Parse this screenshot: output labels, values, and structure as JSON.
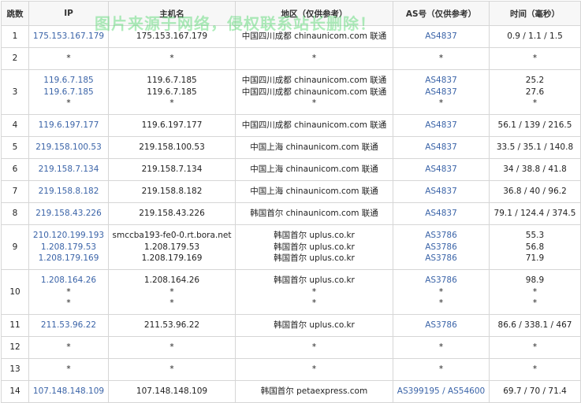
{
  "headers": {
    "hop": "跳数",
    "ip": "IP",
    "host": "主机名",
    "region": "地区（仅供参考）",
    "asn": "AS号（仅供参考）",
    "time": "时间（毫秒）"
  },
  "watermark": "图片来源于网络，侵权联系站长删除！",
  "rows": [
    {
      "hop": "1",
      "ip": [
        "175.153.167.179"
      ],
      "host": [
        "175.153.167.179"
      ],
      "region": [
        "中国四川成都 chinaunicom.com 联通"
      ],
      "asn": [
        "AS4837"
      ],
      "time": [
        "0.9 / 1.1 / 1.5"
      ]
    },
    {
      "hop": "2",
      "ip": [
        "*"
      ],
      "host": [
        "*"
      ],
      "region": [
        "*"
      ],
      "asn": [
        "*"
      ],
      "time": [
        "*"
      ]
    },
    {
      "hop": "3",
      "ip": [
        "119.6.7.185",
        "119.6.7.185",
        "*"
      ],
      "host": [
        "119.6.7.185",
        "119.6.7.185",
        "*"
      ],
      "region": [
        "中国四川成都 chinaunicom.com 联通",
        "中国四川成都 chinaunicom.com 联通",
        "*"
      ],
      "asn": [
        "AS4837",
        "AS4837",
        "*"
      ],
      "time": [
        "25.2",
        "27.6",
        "*"
      ]
    },
    {
      "hop": "4",
      "ip": [
        "119.6.197.177"
      ],
      "host": [
        "119.6.197.177"
      ],
      "region": [
        "中国四川成都 chinaunicom.com 联通"
      ],
      "asn": [
        "AS4837"
      ],
      "time": [
        "56.1 / 139 / 216.5"
      ]
    },
    {
      "hop": "5",
      "ip": [
        "219.158.100.53"
      ],
      "host": [
        "219.158.100.53"
      ],
      "region": [
        "中国上海 chinaunicom.com 联通"
      ],
      "asn": [
        "AS4837"
      ],
      "time": [
        "33.5 / 35.1 / 140.8"
      ]
    },
    {
      "hop": "6",
      "ip": [
        "219.158.7.134"
      ],
      "host": [
        "219.158.7.134"
      ],
      "region": [
        "中国上海 chinaunicom.com 联通"
      ],
      "asn": [
        "AS4837"
      ],
      "time": [
        "34 / 38.8 / 41.8"
      ]
    },
    {
      "hop": "7",
      "ip": [
        "219.158.8.182"
      ],
      "host": [
        "219.158.8.182"
      ],
      "region": [
        "中国上海 chinaunicom.com 联通"
      ],
      "asn": [
        "AS4837"
      ],
      "time": [
        "36.8 / 40 / 96.2"
      ]
    },
    {
      "hop": "8",
      "ip": [
        "219.158.43.226"
      ],
      "host": [
        "219.158.43.226"
      ],
      "region": [
        "韩国首尔 chinaunicom.com 联通"
      ],
      "asn": [
        "AS4837"
      ],
      "time": [
        "79.1 / 124.4 / 374.5"
      ]
    },
    {
      "hop": "9",
      "ip": [
        "210.120.199.193",
        "1.208.179.53",
        "1.208.179.169"
      ],
      "host": [
        "smccba193-fe0-0.rt.bora.net",
        "1.208.179.53",
        "1.208.179.169"
      ],
      "region": [
        "韩国首尔 uplus.co.kr",
        "韩国首尔 uplus.co.kr",
        "韩国首尔 uplus.co.kr"
      ],
      "asn": [
        "AS3786",
        "AS3786",
        "AS3786"
      ],
      "time": [
        "55.3",
        "56.8",
        "71.9"
      ]
    },
    {
      "hop": "10",
      "ip": [
        "1.208.164.26",
        "*",
        "*"
      ],
      "host": [
        "1.208.164.26",
        "*",
        "*"
      ],
      "region": [
        "韩国首尔 uplus.co.kr",
        "*",
        "*"
      ],
      "asn": [
        "AS3786",
        "*",
        "*"
      ],
      "time": [
        "98.9",
        "*",
        "*"
      ]
    },
    {
      "hop": "11",
      "ip": [
        "211.53.96.22"
      ],
      "host": [
        "211.53.96.22"
      ],
      "region": [
        "韩国首尔 uplus.co.kr"
      ],
      "asn": [
        "AS3786"
      ],
      "time": [
        "86.6 / 338.1 / 467"
      ]
    },
    {
      "hop": "12",
      "ip": [
        "*"
      ],
      "host": [
        "*"
      ],
      "region": [
        "*"
      ],
      "asn": [
        "*"
      ],
      "time": [
        "*"
      ]
    },
    {
      "hop": "13",
      "ip": [
        "*"
      ],
      "host": [
        "*"
      ],
      "region": [
        "*"
      ],
      "asn": [
        "*"
      ],
      "time": [
        "*"
      ]
    },
    {
      "hop": "14",
      "ip": [
        "107.148.148.109"
      ],
      "host": [
        "107.148.148.109"
      ],
      "region": [
        "韩国首尔 petaexpress.com"
      ],
      "asn": [
        "AS399195 / AS54600"
      ],
      "time": [
        "69.7 / 70 / 71.4"
      ]
    }
  ]
}
